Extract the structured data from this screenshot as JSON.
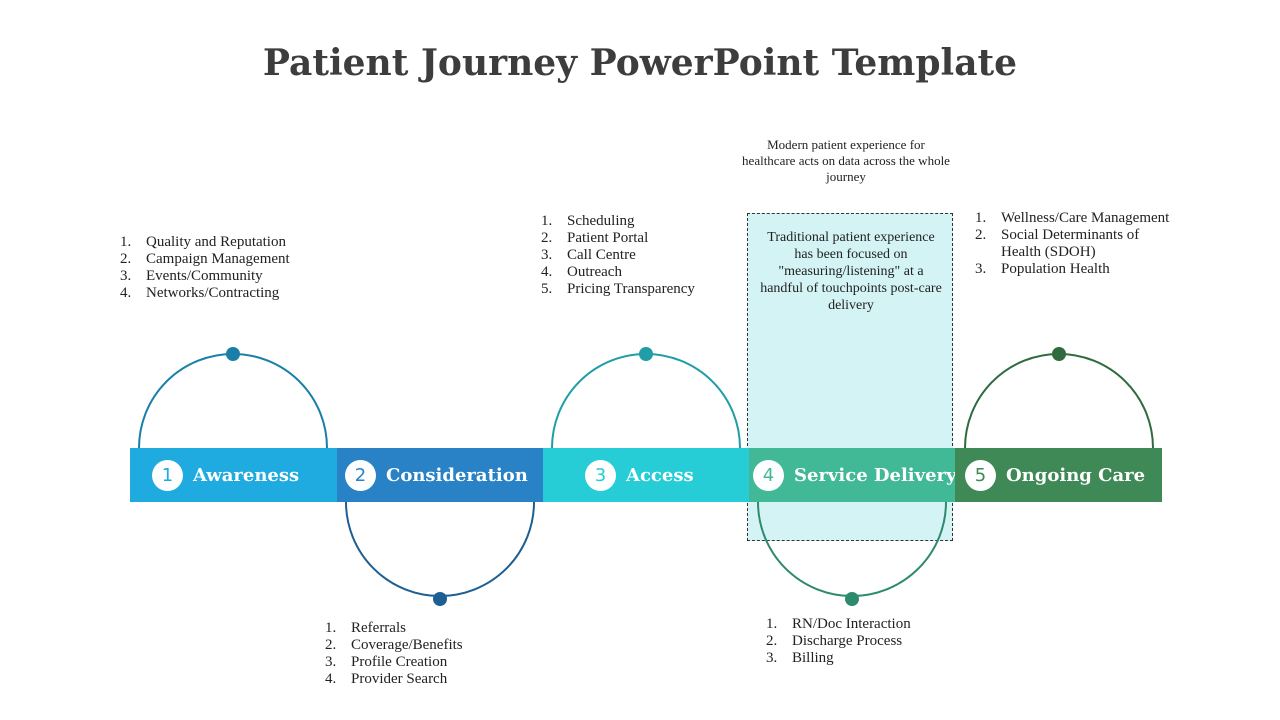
{
  "title": "Patient Journey PowerPoint Template",
  "note": "Modern patient experience for healthcare acts on data across the whole journey",
  "callout": "Traditional patient experience has been focused on \"measuring/listening\" at a handful of touchpoints post-care delivery",
  "stages": [
    {
      "number": "1",
      "label": "Awareness",
      "color": "#1fabe0",
      "arc_color": "#1a7fa8",
      "items": [
        "Quality and Reputation",
        "Campaign Management",
        "Events/Community",
        "Networks/Contracting"
      ]
    },
    {
      "number": "2",
      "label": "Consideration",
      "color": "#2882c5",
      "arc_color": "#1e5f93",
      "items": [
        "Referrals",
        "Coverage/Benefits",
        "Profile Creation",
        "Provider Search"
      ]
    },
    {
      "number": "3",
      "label": "Access",
      "color": "#26ccd6",
      "arc_color": "#1f9ea6",
      "items": [
        "Scheduling",
        "Patient Portal",
        "Call Centre",
        "Outreach",
        "Pricing Transparency"
      ]
    },
    {
      "number": "4",
      "label": "Service Delivery",
      "color": "#42b996",
      "arc_color": "#2e8a6d",
      "items": [
        "RN/Doc Interaction",
        "Discharge Process",
        "Billing"
      ]
    },
    {
      "number": "5",
      "label": "Ongoing Care",
      "color": "#3e8955",
      "arc_color": "#2f6b3f",
      "items": [
        "Wellness/Care Management",
        "Social Determinants of Health (SDOH)",
        "Population Health"
      ]
    }
  ],
  "numbers": [
    "1.",
    "2.",
    "3.",
    "4.",
    "5."
  ]
}
